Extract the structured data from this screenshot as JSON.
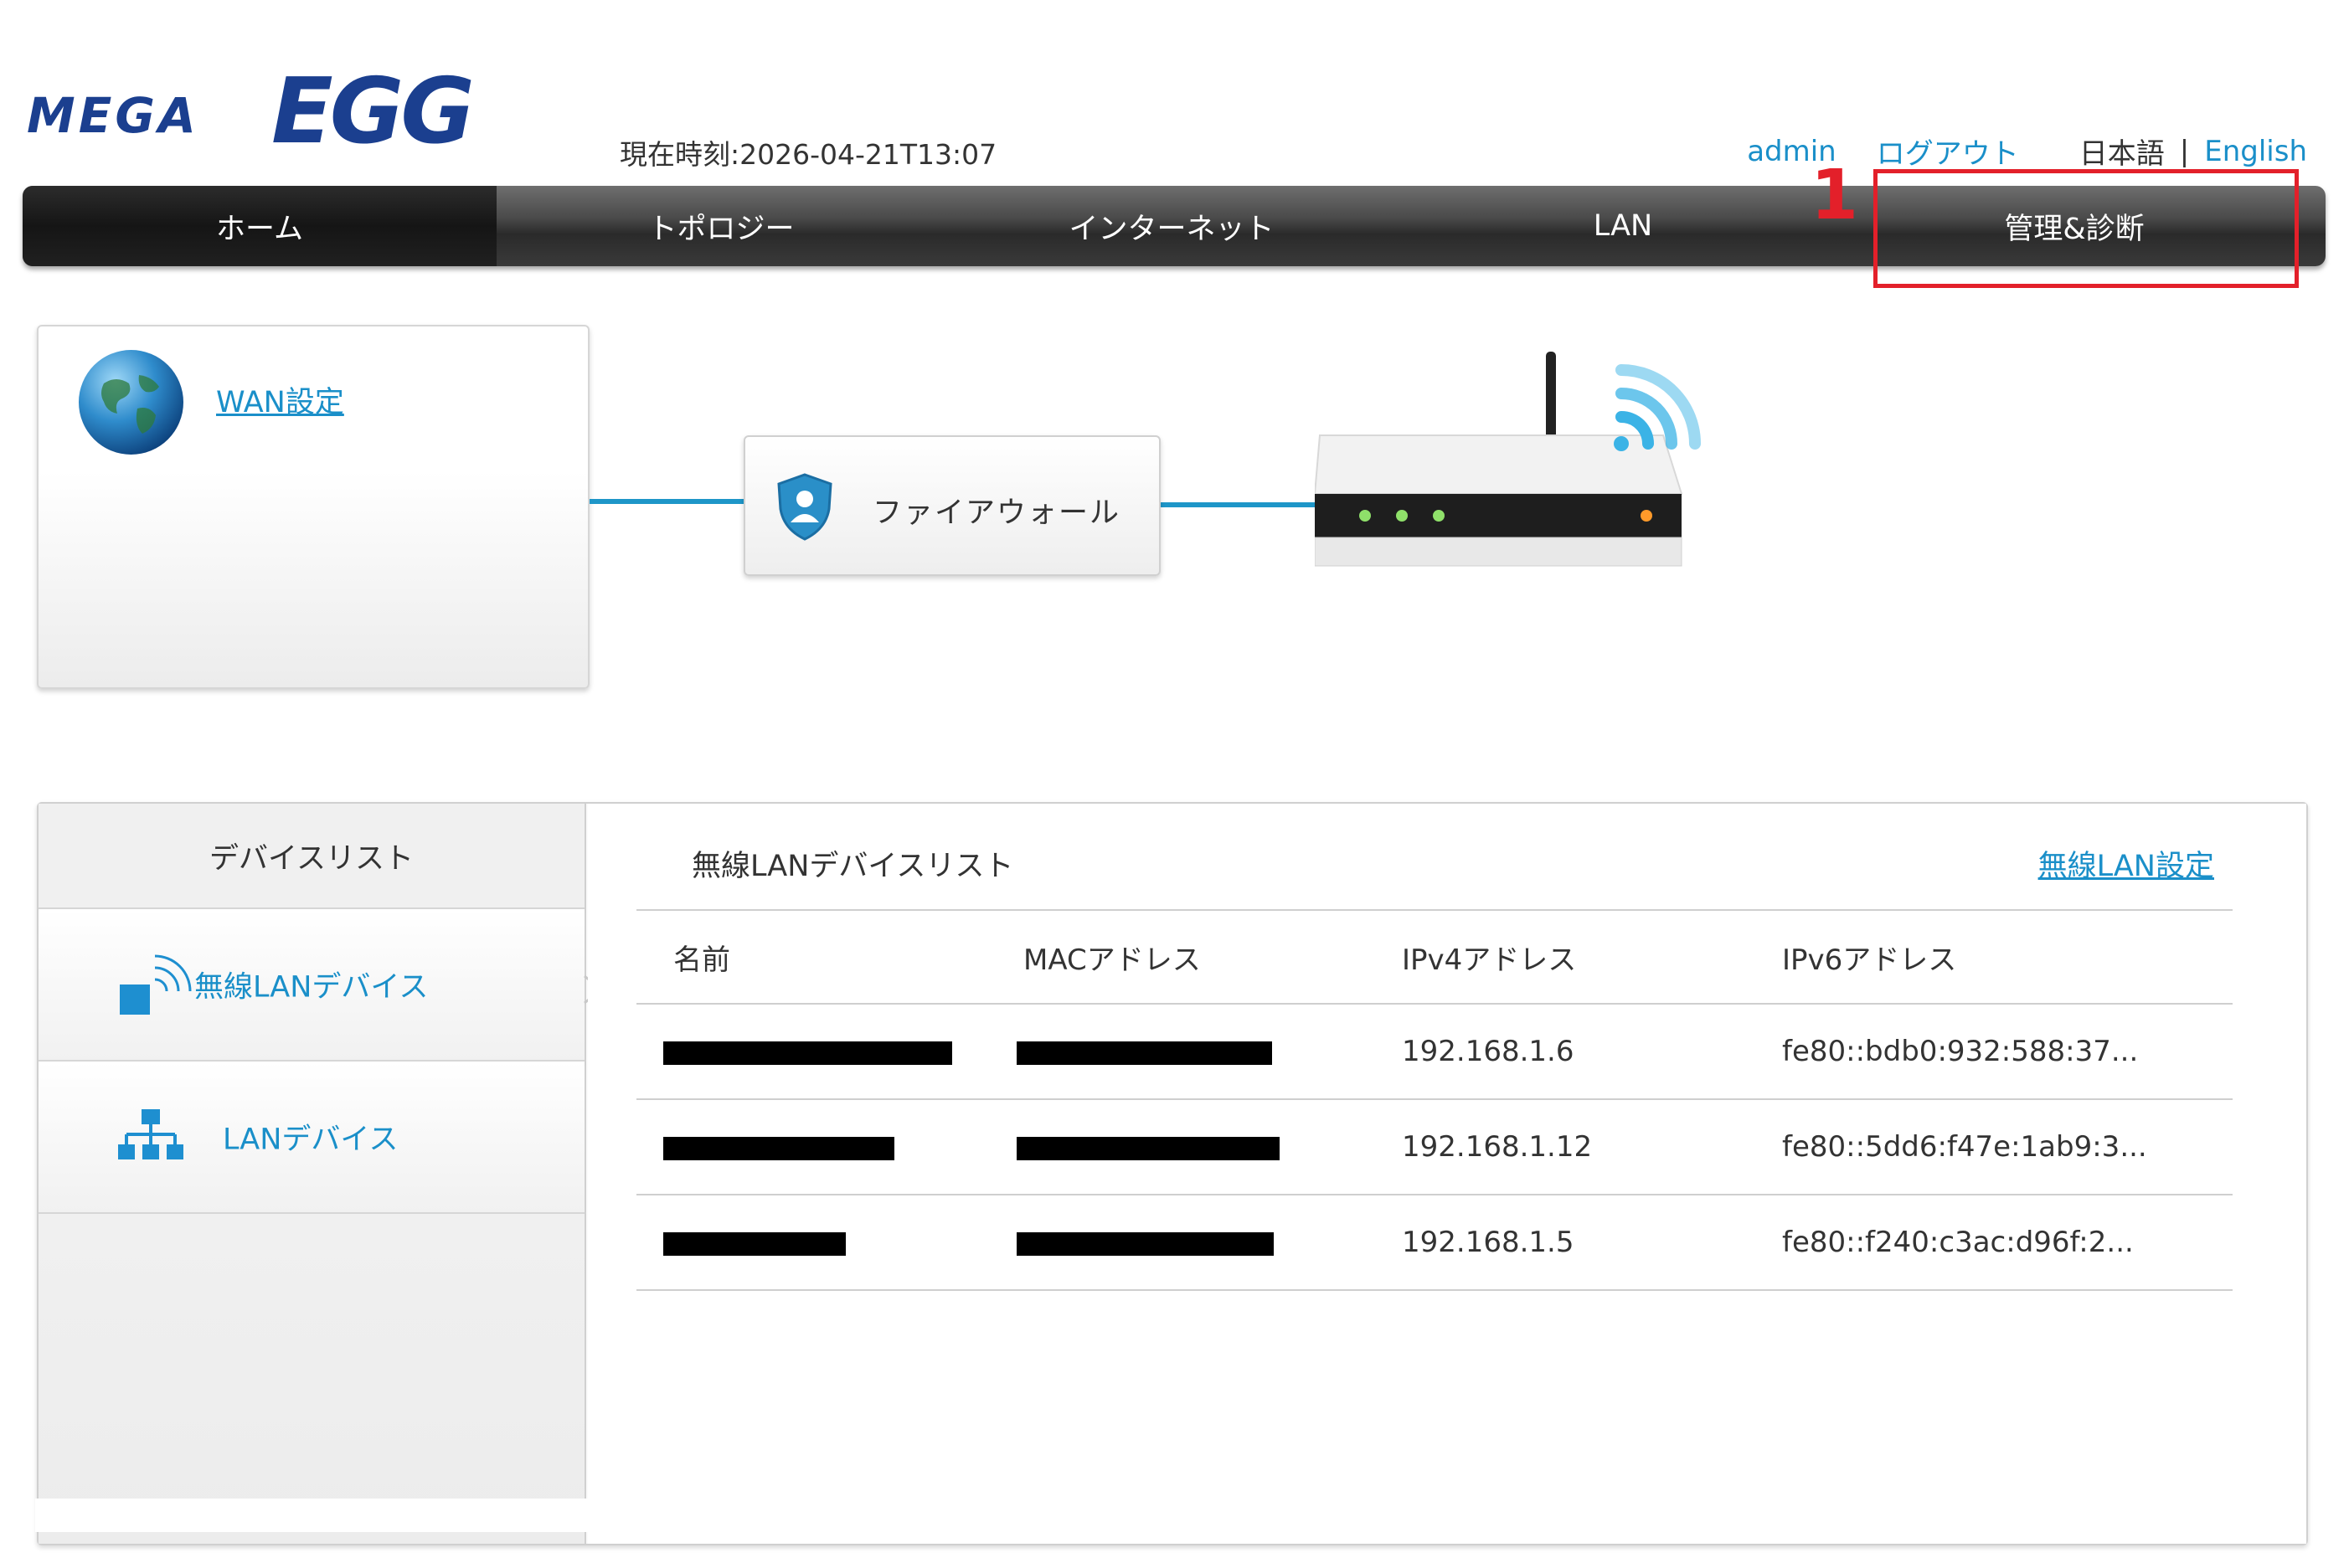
{
  "header": {
    "logo_text": "MEGA EGG",
    "clock": "現在時刻:2026-04-21T13:07",
    "user": "admin",
    "logout": "ログアウト",
    "lang_ja": "日本語",
    "lang_sep": "|",
    "lang_en": "English"
  },
  "nav": {
    "tabs": [
      {
        "label": "ホーム",
        "active": true
      },
      {
        "label": "トポロジー"
      },
      {
        "label": "インターネット"
      },
      {
        "label": "LAN"
      },
      {
        "label": "管理&診断"
      }
    ],
    "highlight_number": "1"
  },
  "topology": {
    "wan_link": "WAN設定",
    "firewall_label": "ファイアウォール"
  },
  "devices": {
    "sidebar_title": "デバイスリスト",
    "wireless_item": "無線LANデバイス",
    "lan_item": "LANデバイス",
    "list_title": "無線LANデバイスリスト",
    "settings_link": "無線LAN設定",
    "columns": [
      "名前",
      "MACアドレス",
      "IPv4アドレス",
      "IPv6アドレス"
    ],
    "rows": [
      {
        "ipv4": "192.168.1.6",
        "ipv6": "fe80::bdb0:932:588:37..."
      },
      {
        "ipv4": "192.168.1.12",
        "ipv6": "fe80::5dd6:f47e:1ab9:3..."
      },
      {
        "ipv4": "192.168.1.5",
        "ipv6": "fe80::f240:c3ac:d96f:2..."
      }
    ]
  },
  "colors": {
    "link": "#1a8fc9",
    "highlight": "#e3202a",
    "line": "#1e96c8"
  }
}
